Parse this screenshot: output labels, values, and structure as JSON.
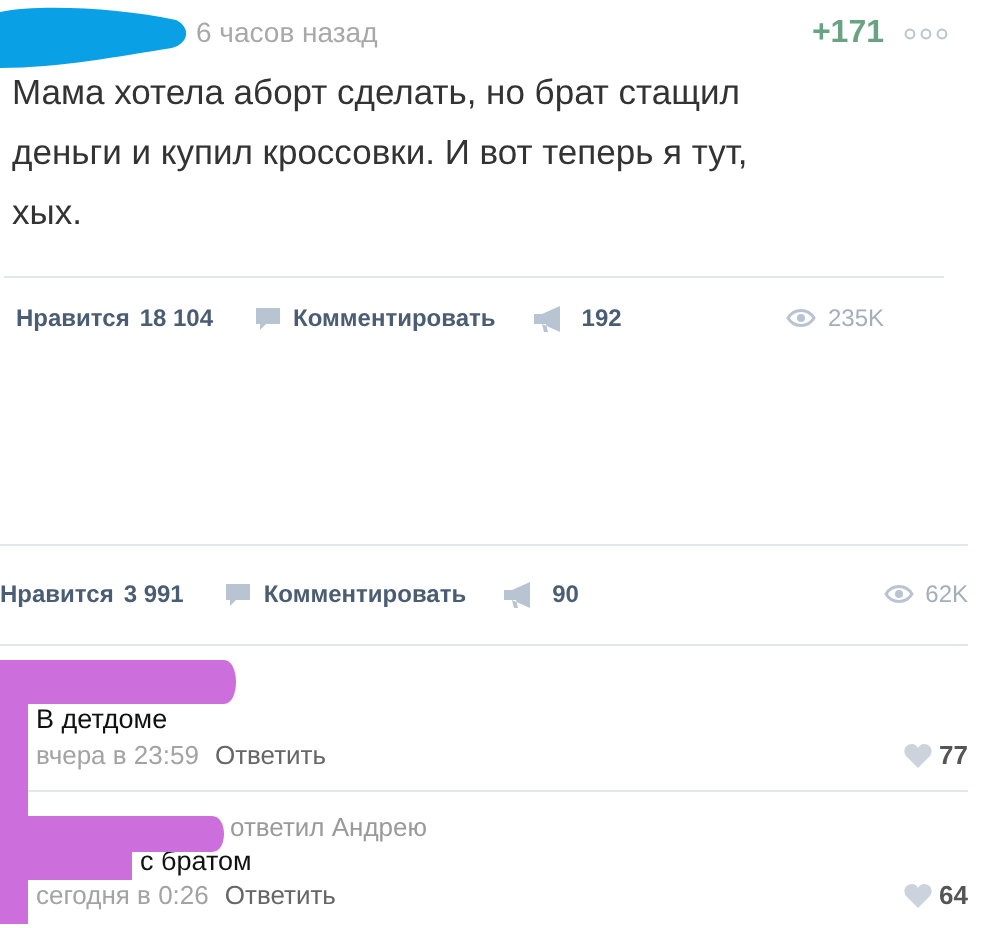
{
  "post": {
    "time": "6 часов назад",
    "rating": "+171",
    "text": "Мама хотела аборт сделать, но брат стащил деньги и купил кроссовки. И вот теперь я тут, хых."
  },
  "action_bars": [
    {
      "like_label": "Нравится",
      "likes": "18 104",
      "comment_label": "Комментировать",
      "shares": "192",
      "views": "235K"
    },
    {
      "like_label": "Нравится",
      "likes": "3 991",
      "comment_label": "Комментировать",
      "shares": "90",
      "views": "62K"
    }
  ],
  "comments": [
    {
      "text": "В детдоме",
      "time": "вчера в 23:59",
      "reply_label": "Ответить",
      "likes": "77"
    },
    {
      "reply_to": "ответил Андрею",
      "text": "с братом",
      "time": "сегодня в 0:26",
      "reply_label": "Ответить",
      "likes": "64"
    }
  ]
}
